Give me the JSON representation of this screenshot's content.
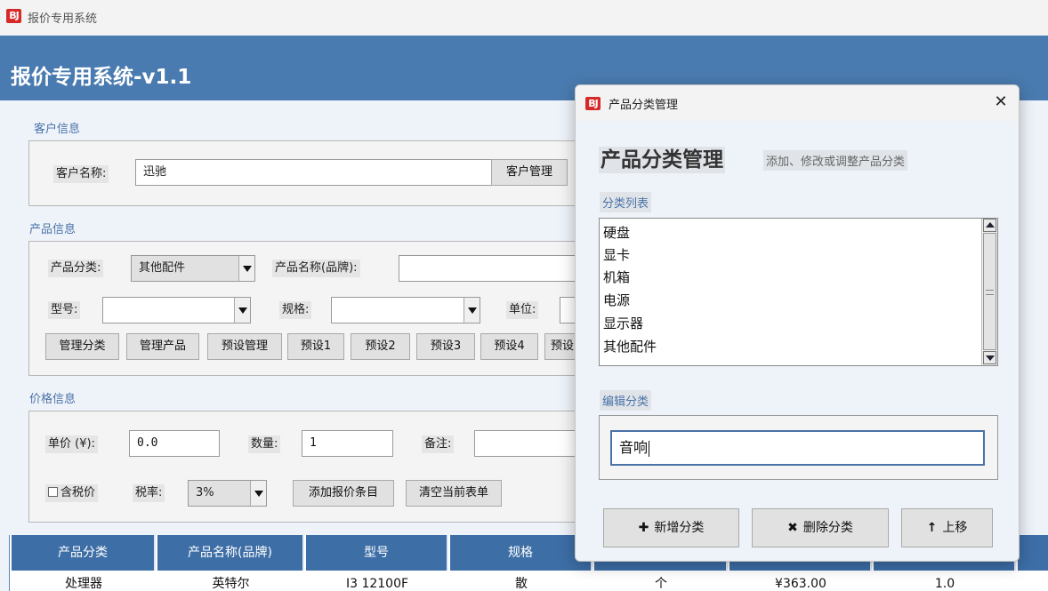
{
  "window": {
    "logo": "BJ",
    "title": "报价专用系统"
  },
  "header": {
    "title": "报价专用系统-v1.1"
  },
  "customer": {
    "section_label": "客户信息",
    "name_label": "客户名称:",
    "name_value": "迅驰",
    "manage_button": "客户管理"
  },
  "product": {
    "section_label": "产品信息",
    "category_label": "产品分类:",
    "category_value": "其他配件",
    "name_label": "产品名称(品牌):",
    "model_label": "型号:",
    "spec_label": "规格:",
    "unit_label": "单位:",
    "buttons": [
      "管理分类",
      "管理产品",
      "预设管理",
      "预设1",
      "预设2",
      "预设3",
      "预设4",
      "预设"
    ]
  },
  "price": {
    "section_label": "价格信息",
    "unit_price_label": "单价 (¥):",
    "unit_price_value": "0.0",
    "qty_label": "数量:",
    "qty_value": "1",
    "note_label": "备注:",
    "tax_checkbox_label": "含税价",
    "tax_rate_label": "税率:",
    "tax_rate_value": "3%",
    "add_button": "添加报价条目",
    "clear_button": "清空当前表单"
  },
  "table": {
    "headers": [
      "产品分类",
      "产品名称(品牌)",
      "型号",
      "规格"
    ],
    "row": [
      "处理器",
      "英特尔",
      "I3 12100F",
      "散",
      "个",
      "¥363.00",
      "1.0"
    ]
  },
  "dialog": {
    "logo": "BJ",
    "title": "产品分类管理",
    "close_glyph": "✕",
    "heading": "产品分类管理",
    "subtitle": "添加、修改或调整产品分类",
    "list_label": "分类列表",
    "list_items": [
      "硬盘",
      "显卡",
      "机箱",
      "电源",
      "显示器",
      "其他配件"
    ],
    "edit_label": "编辑分类",
    "edit_value": "音响",
    "buttons": [
      {
        "glyph": "✚",
        "label": "新增分类"
      },
      {
        "glyph": "✖",
        "label": "删除分类"
      },
      {
        "glyph": "↑",
        "label": "上移"
      }
    ]
  }
}
